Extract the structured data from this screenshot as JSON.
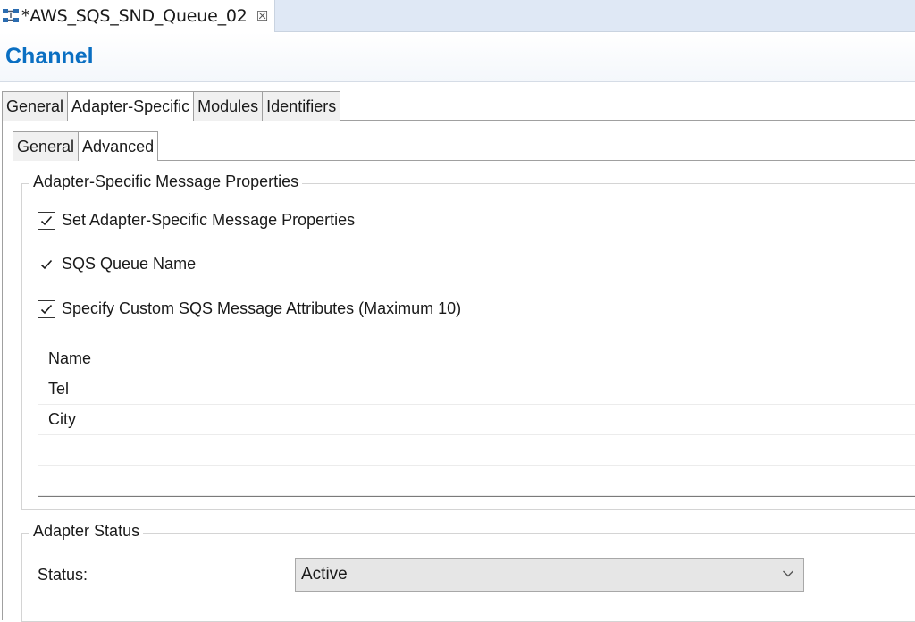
{
  "editor": {
    "tab_title": "*AWS_SQS_SND_Queue_02",
    "tab_icon": "channel-icon",
    "close_glyph": "☒"
  },
  "header": {
    "title": "Channel"
  },
  "tabs": [
    {
      "label": "General",
      "active": false
    },
    {
      "label": "Adapter-Specific",
      "active": true
    },
    {
      "label": "Modules",
      "active": false
    },
    {
      "label": "Identifiers",
      "active": false
    }
  ],
  "subtabs": [
    {
      "label": "General",
      "active": false
    },
    {
      "label": "Advanced",
      "active": true
    }
  ],
  "properties_group": {
    "legend": "Adapter-Specific Message Properties",
    "checks": [
      {
        "label": "Set Adapter-Specific Message Properties",
        "checked": true
      },
      {
        "label": "SQS Queue Name",
        "checked": true
      },
      {
        "label": "Specify Custom SQS Message Attributes (Maximum 10)",
        "checked": true
      }
    ],
    "attributes": [
      "Name",
      "Tel",
      "City",
      "",
      ""
    ]
  },
  "status_group": {
    "legend": "Adapter Status",
    "status_label": "Status:",
    "status_value": "Active"
  },
  "colors": {
    "title": "#0a6fc2",
    "tabbar": "#dfe8f5"
  }
}
